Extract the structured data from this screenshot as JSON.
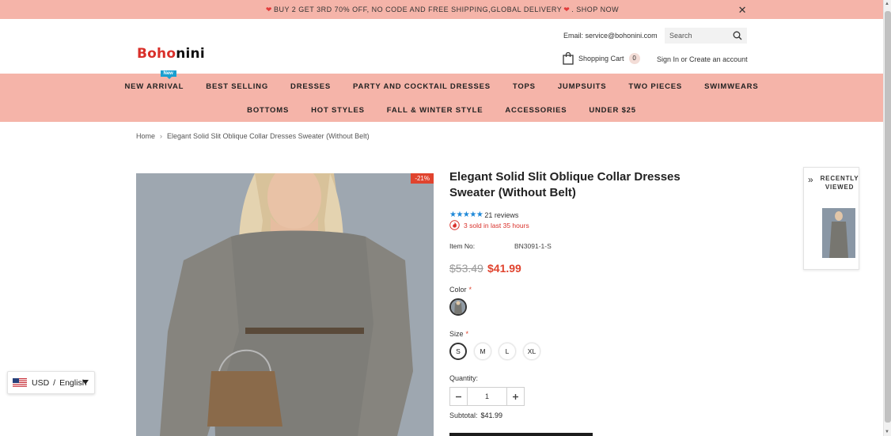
{
  "announcement": {
    "text": "BUY 2 GET 3RD 70% OFF, NO CODE AND FREE SHIPPING,GLOBAL DELIVERY",
    "link": ". SHOP NOW"
  },
  "header": {
    "logo": {
      "part1": "Boho",
      "part2": "nini"
    },
    "email": "Email: service@bohonini.com",
    "search_placeholder": "Search",
    "cart_label": "Shopping Cart",
    "cart_count": "0",
    "sign_in": "Sign In",
    "or": " or ",
    "create_account": "Create an account"
  },
  "nav": {
    "row1": [
      "NEW ARRIVAL",
      "BEST SELLING",
      "DRESSES",
      "PARTY AND COCKTAIL DRESSES",
      "TOPS",
      "JUMPSUITS",
      "TWO PIECES",
      "SWIMWEARS"
    ],
    "row2": [
      "BOTTOMS",
      "HOT STYLES",
      "FALL & WINTER STYLE",
      "ACCESSORIES",
      "UNDER $25"
    ],
    "new_badge": "New"
  },
  "breadcrumb": {
    "home": "Home",
    "current": "Elegant Solid Slit Oblique Collar Dresses Sweater (Without Belt)"
  },
  "product": {
    "discount": "-21%",
    "title": "Elegant Solid Slit Oblique Collar Dresses Sweater (Without Belt)",
    "stars": "★★★★★",
    "reviews": "21 reviews",
    "sold": "3 sold in last 35 hours",
    "item_label": "Item No:",
    "item_no": "BN3091-1-S",
    "old_price": "$53.49",
    "price": "$41.99",
    "color_label": "Color",
    "size_label": "Size",
    "sizes": [
      "S",
      "M",
      "L",
      "XL"
    ],
    "selected_size": "S",
    "quantity_label": "Quantity:",
    "quantity": "1",
    "subtotal_label": "Subtotal:",
    "subtotal": "$41.99",
    "required_mark": "*"
  },
  "recently_viewed": {
    "title": "RECENTLY VIEWED"
  },
  "locale": {
    "currency": "USD",
    "separator": "/",
    "language": "English"
  },
  "colors": {
    "accent": "#e0432e",
    "nav_bg": "#f5b4a9",
    "star": "#1e88d8",
    "badge": "#1a9fd0"
  }
}
